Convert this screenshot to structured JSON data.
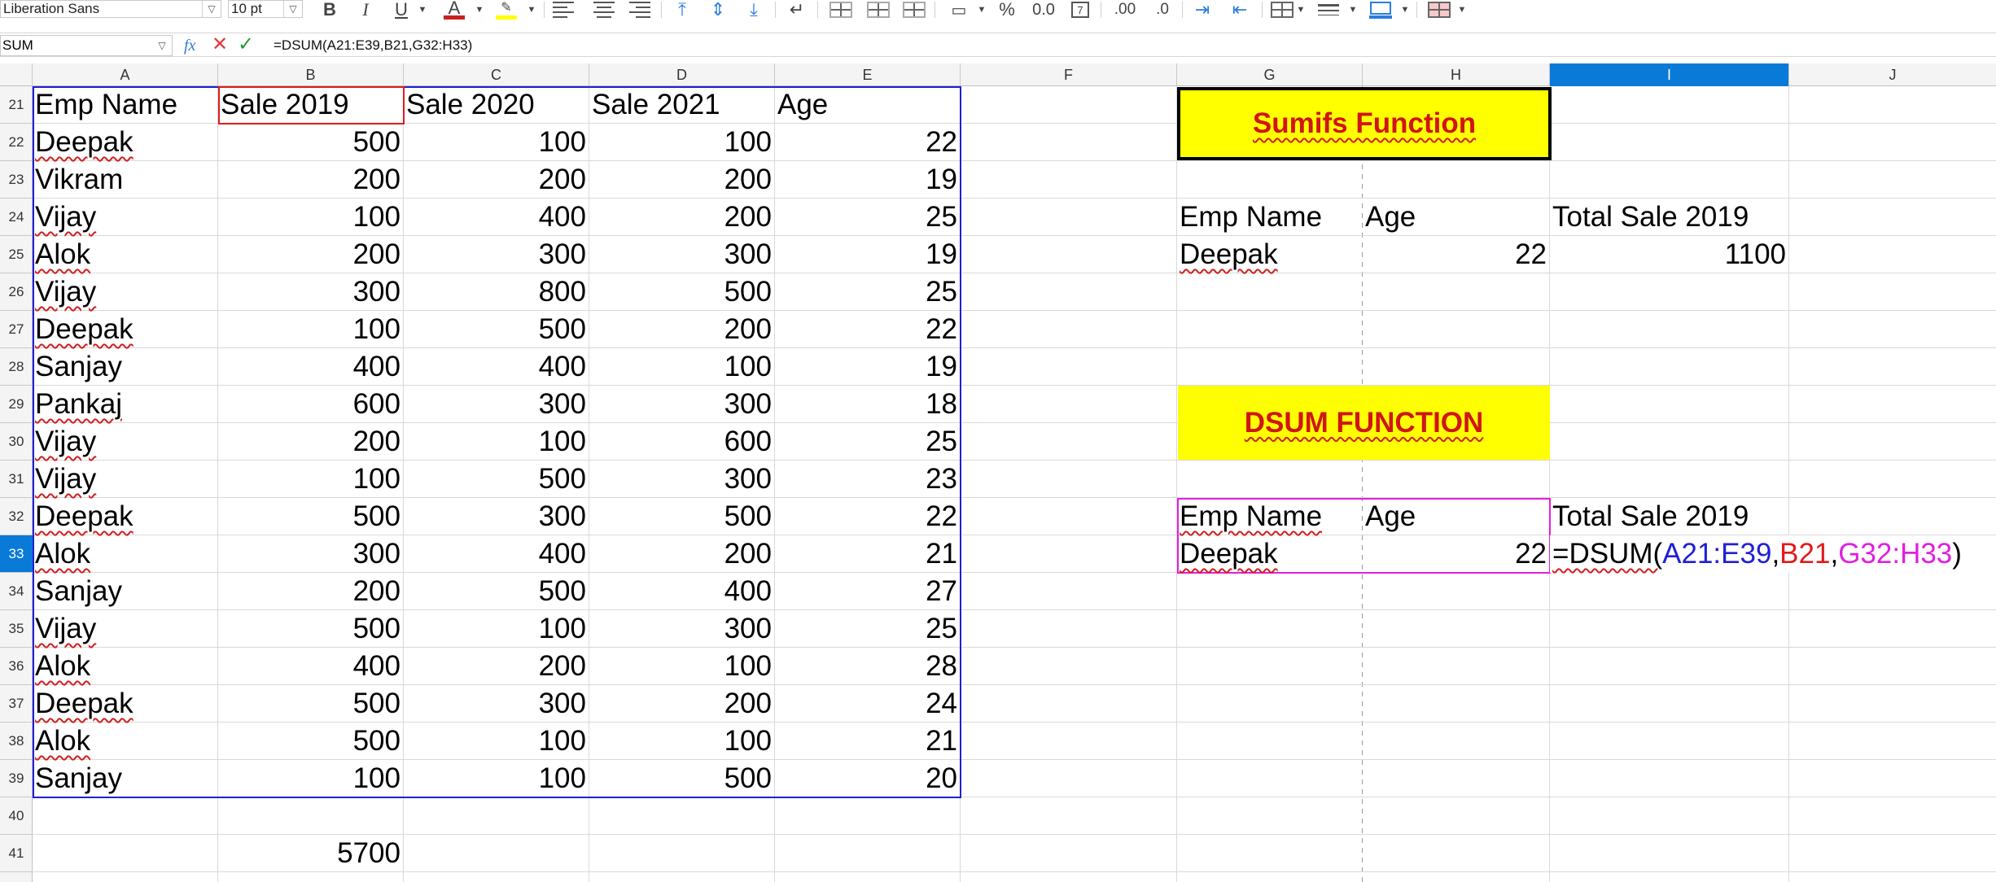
{
  "toolbar": {
    "font_name": "Liberation Sans",
    "font_size": "10 pt",
    "icons": [
      "bold-icon",
      "italic-icon",
      "underline-icon",
      "font-color-icon",
      "highlight-icon",
      "align-left-icon",
      "align-center-icon",
      "align-right-icon",
      "align-top-icon",
      "align-middle-icon",
      "align-bottom-icon",
      "wrap-text-icon",
      "merge-cells-icon",
      "merge-center-icon",
      "unmerge-icon",
      "currency-icon",
      "percent-icon",
      "number-format-icon",
      "date-format-icon",
      "add-decimal-icon",
      "delete-decimal-icon",
      "indent-increase-icon",
      "indent-decrease-icon",
      "borders-icon",
      "border-style-icon",
      "border-color-icon",
      "conditional-format-icon"
    ],
    "bold": "B",
    "italic": "I",
    "underline": "U",
    "font_color_letter": "A",
    "percent": "%",
    "number_format": "0.0",
    "add_decimal": ".00",
    "delete_decimal": ".0"
  },
  "formula_bar": {
    "name_box": "SUM",
    "fx": "fx",
    "cancel": "✕",
    "accept": "✓",
    "formula": "=DSUM(A21:E39,B21,G32:H33)"
  },
  "columns": [
    "A",
    "B",
    "C",
    "D",
    "E",
    "F",
    "G",
    "H",
    "I",
    "J"
  ],
  "rows": [
    "21",
    "22",
    "23",
    "24",
    "25",
    "26",
    "27",
    "28",
    "29",
    "30",
    "31",
    "32",
    "33",
    "34",
    "35",
    "36",
    "37",
    "38",
    "39",
    "40",
    "41"
  ],
  "table": {
    "headers": [
      "Emp Name",
      "Sale 2019",
      "Sale 2020",
      "Sale 2021",
      "Age"
    ],
    "rows": [
      [
        "Deepak",
        "500",
        "100",
        "100",
        "22"
      ],
      [
        "Vikram",
        "200",
        "200",
        "200",
        "19"
      ],
      [
        "Vijay",
        "100",
        "400",
        "200",
        "25"
      ],
      [
        "Alok",
        "200",
        "300",
        "300",
        "19"
      ],
      [
        "Vijay",
        "300",
        "800",
        "500",
        "25"
      ],
      [
        "Deepak",
        "100",
        "500",
        "200",
        "22"
      ],
      [
        "Sanjay",
        "400",
        "400",
        "100",
        "19"
      ],
      [
        "Pankaj",
        "600",
        "300",
        "300",
        "18"
      ],
      [
        "Vijay",
        "200",
        "100",
        "600",
        "25"
      ],
      [
        "Vijay",
        "100",
        "500",
        "300",
        "23"
      ],
      [
        "Deepak",
        "500",
        "300",
        "500",
        "22"
      ],
      [
        "Alok",
        "300",
        "400",
        "200",
        "21"
      ],
      [
        "Sanjay",
        "200",
        "500",
        "400",
        "27"
      ],
      [
        "Vijay",
        "500",
        "100",
        "300",
        "25"
      ],
      [
        "Alok",
        "400",
        "200",
        "100",
        "28"
      ],
      [
        "Deepak",
        "500",
        "300",
        "200",
        "24"
      ],
      [
        "Alok",
        "500",
        "100",
        "100",
        "21"
      ],
      [
        "Sanjay",
        "100",
        "100",
        "500",
        "20"
      ]
    ],
    "total": "5700"
  },
  "sumifs": {
    "title": "Sumifs Function",
    "h_name": "Emp Name",
    "h_age": "Age",
    "h_total": "Total Sale 2019",
    "name": "Deepak",
    "age": "22",
    "total": "1100"
  },
  "dsum": {
    "title": "DSUM FUNCTION",
    "h_name": "Emp Name",
    "h_age": "Age",
    "h_total": "Total Sale 2019",
    "name": "Deepak",
    "age": "22",
    "f_prefix": "=DSUM(",
    "f_range": "A21:E39",
    "f_comma1": ",",
    "f_field": "B21",
    "f_comma2": ",",
    "f_criteria": "G32:H33",
    "f_suffix": ")"
  },
  "colors": {
    "selection_blue": "#0a7ad8",
    "banner_yellow": "#ffff00",
    "banner_text": "#d01515",
    "ref_blue": "#1f1fd6",
    "ref_red": "#e01b1b",
    "ref_magenta": "#e020e0"
  }
}
